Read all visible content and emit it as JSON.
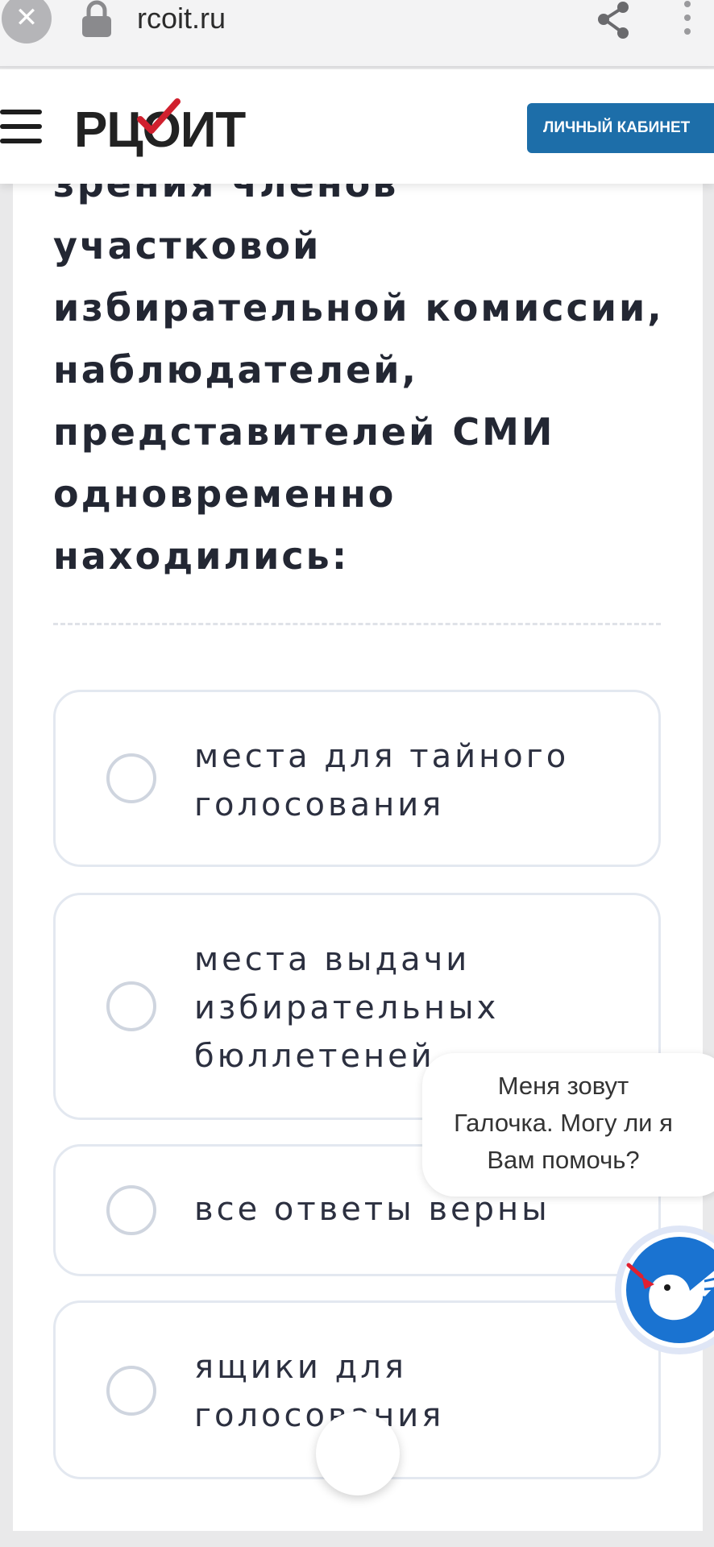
{
  "browser": {
    "url": "rcoit.ru",
    "close_symbol": "✕"
  },
  "header": {
    "logo_text": "РЦОИТ",
    "cabinet_button": "ЛИЧНЫЙ КАБИНЕТ"
  },
  "question": {
    "lines": [
      "зрения членов",
      "участковой",
      "избирательной комиссии,",
      "наблюдателей,",
      "представителей СМИ",
      "одновременно",
      "находились:"
    ]
  },
  "answers": [
    {
      "lines": [
        "места для тайного",
        "голосования"
      ]
    },
    {
      "lines": [
        "места выдачи",
        "избирательных",
        "бюллетеней"
      ]
    },
    {
      "lines": [
        "все ответы верны"
      ]
    },
    {
      "lines": [
        "ящики для",
        "голосования"
      ]
    }
  ],
  "chat": {
    "lines": [
      "Меня зовут",
      "Галочка. Могу ли я",
      "Вам помочь?"
    ]
  },
  "colors": {
    "brand_blue": "#1d6ea9",
    "logo_check_red": "#d0202e",
    "text_dark": "#232733",
    "option_border": "#e3e8f0"
  },
  "icons": [
    "close-icon",
    "lock-icon",
    "share-icon",
    "more-vert-icon",
    "hamburger-icon",
    "galochka-bird-icon"
  ]
}
